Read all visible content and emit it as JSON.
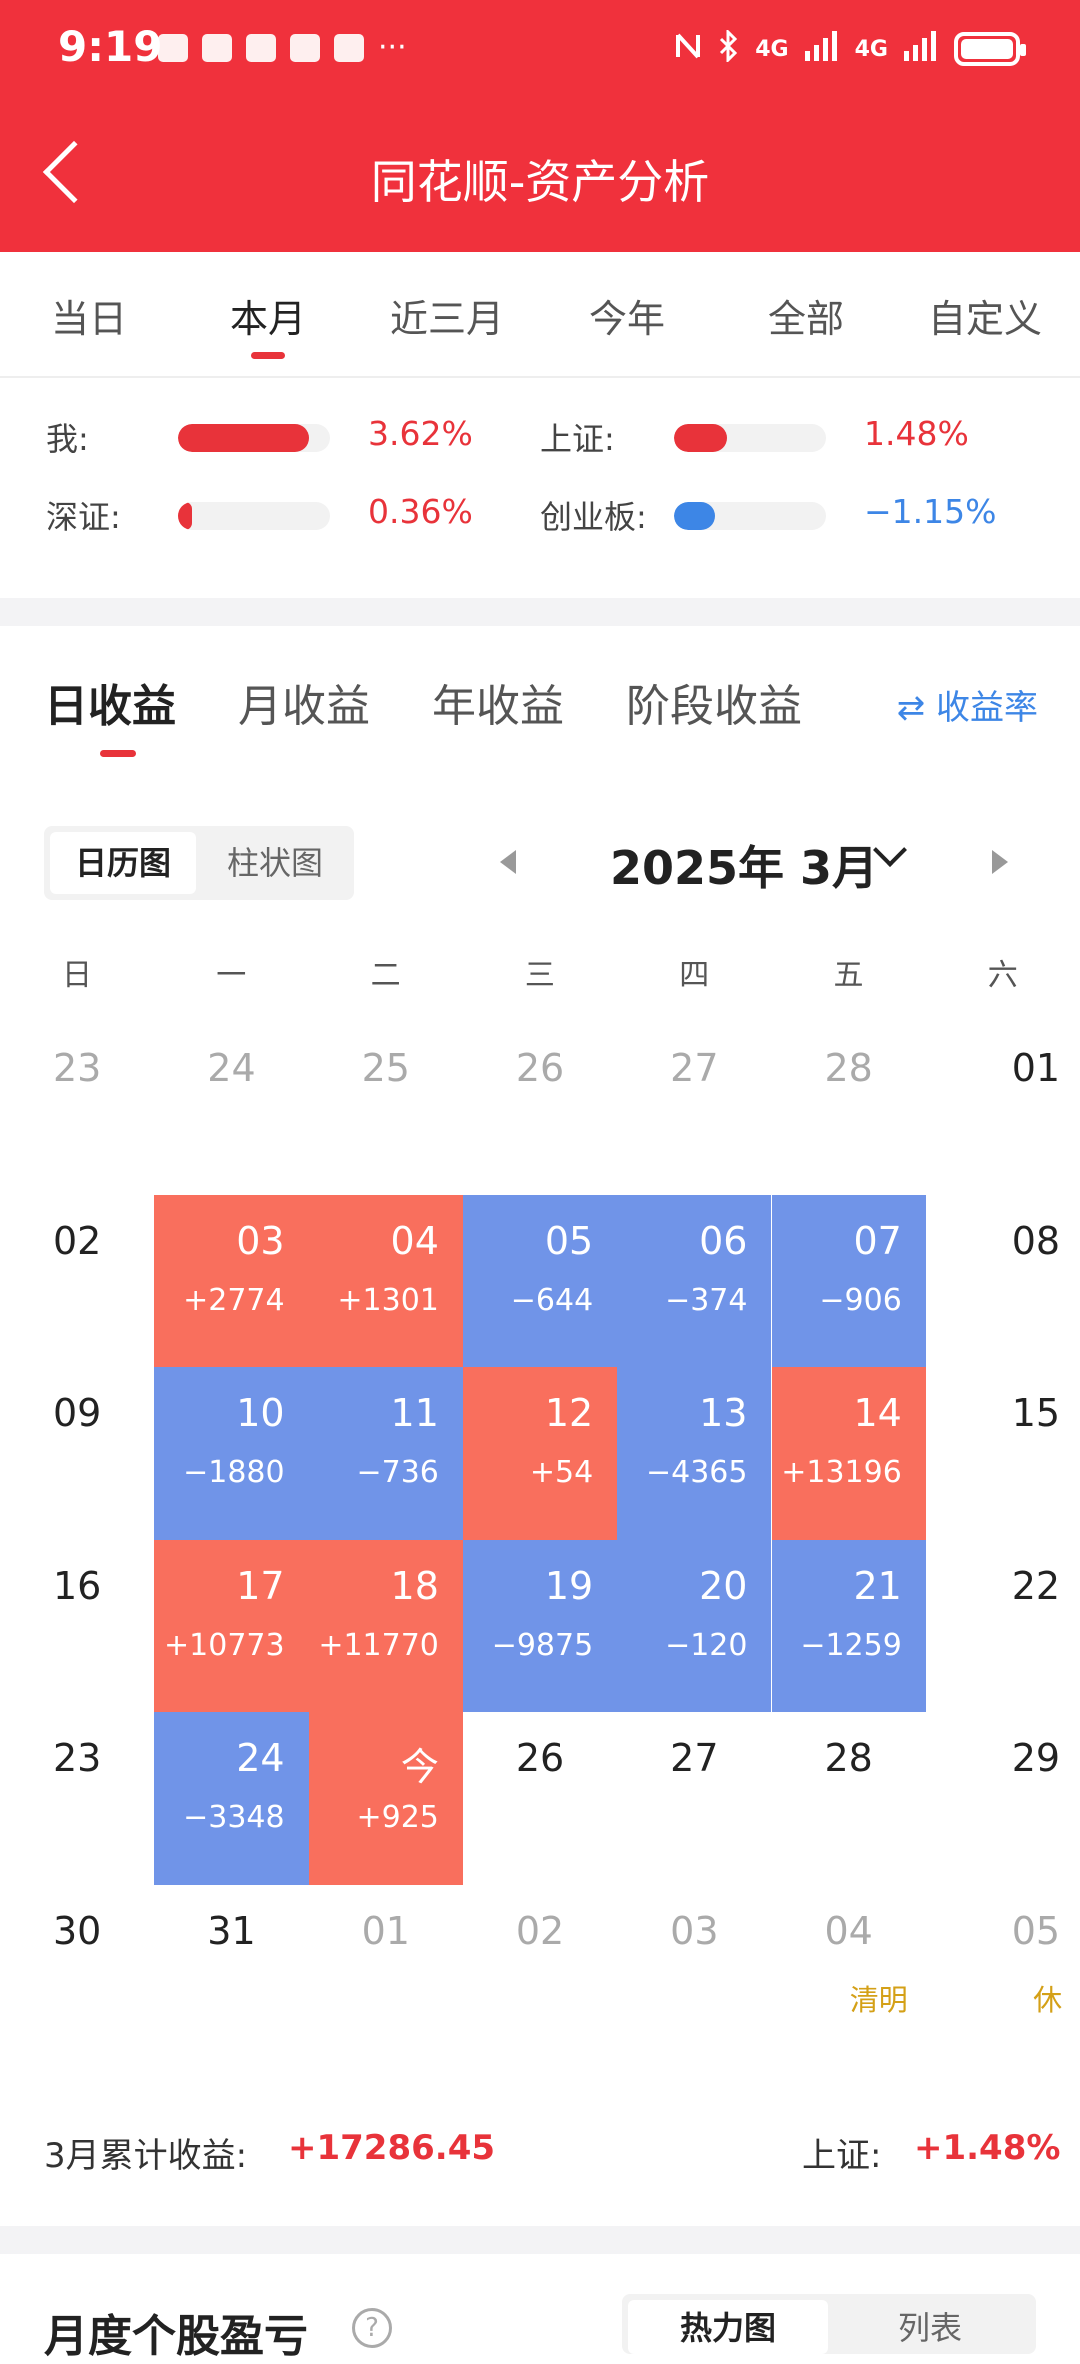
{
  "status": {
    "time": "9:19",
    "more": "···",
    "signal1": "4G",
    "signal2": "4G"
  },
  "nav": {
    "title": "同花顺-资产分析"
  },
  "period_tabs": [
    "当日",
    "本月",
    "近三月",
    "今年",
    "全部",
    "自定义"
  ],
  "period_active": 1,
  "compare": {
    "me": {
      "label": "我:",
      "value": "3.62%",
      "fill": 0.86,
      "color": "#e8333a"
    },
    "shanghai": {
      "label": "上证:",
      "value": "1.48%",
      "fill": 0.35,
      "color": "#e8333a"
    },
    "shenzhen": {
      "label": "深证:",
      "value": "0.36%",
      "fill": 0.09,
      "color": "#e8333a"
    },
    "chinext": {
      "label": "创业板:",
      "value": "−1.15%",
      "fill": 0.27,
      "color": "#3d86e6"
    }
  },
  "earn_tabs": [
    "日收益",
    "月收益",
    "年收益",
    "阶段收益"
  ],
  "rate_toggle": "⇄ 收益率",
  "view_toggle": {
    "calendar": "日历图",
    "bar": "柱状图"
  },
  "month_label": "2025年 3月",
  "weekdays": [
    "日",
    "一",
    "二",
    "三",
    "四",
    "五",
    "六"
  ],
  "calendar": [
    [
      {
        "d": "23",
        "s": "muted"
      },
      {
        "d": "24",
        "s": "muted"
      },
      {
        "d": "25",
        "s": "muted"
      },
      {
        "d": "26",
        "s": "muted"
      },
      {
        "d": "27",
        "s": "muted"
      },
      {
        "d": "28",
        "s": "muted"
      },
      {
        "d": "01",
        "s": "plain"
      }
    ],
    [
      {
        "d": "02",
        "s": "plain"
      },
      {
        "d": "03",
        "s": "up",
        "v": "+2774"
      },
      {
        "d": "04",
        "s": "up",
        "v": "+1301"
      },
      {
        "d": "05",
        "s": "down",
        "v": "−644"
      },
      {
        "d": "06",
        "s": "down",
        "v": "−374"
      },
      {
        "d": "07",
        "s": "down",
        "v": "−906"
      },
      {
        "d": "08",
        "s": "plain"
      }
    ],
    [
      {
        "d": "09",
        "s": "plain"
      },
      {
        "d": "10",
        "s": "down",
        "v": "−1880"
      },
      {
        "d": "11",
        "s": "down",
        "v": "−736"
      },
      {
        "d": "12",
        "s": "up",
        "v": "+54"
      },
      {
        "d": "13",
        "s": "down",
        "v": "−4365"
      },
      {
        "d": "14",
        "s": "up",
        "v": "+13196"
      },
      {
        "d": "15",
        "s": "plain"
      }
    ],
    [
      {
        "d": "16",
        "s": "plain"
      },
      {
        "d": "17",
        "s": "up",
        "v": "+10773"
      },
      {
        "d": "18",
        "s": "up",
        "v": "+11770"
      },
      {
        "d": "19",
        "s": "down",
        "v": "−9875"
      },
      {
        "d": "20",
        "s": "down",
        "v": "−120"
      },
      {
        "d": "21",
        "s": "down",
        "v": "−1259"
      },
      {
        "d": "22",
        "s": "plain"
      }
    ],
    [
      {
        "d": "23",
        "s": "plain"
      },
      {
        "d": "24",
        "s": "down",
        "v": "−3348"
      },
      {
        "d": "今",
        "s": "up",
        "v": "+925"
      },
      {
        "d": "26",
        "s": "plain"
      },
      {
        "d": "27",
        "s": "plain"
      },
      {
        "d": "28",
        "s": "plain"
      },
      {
        "d": "29",
        "s": "plain"
      }
    ],
    [
      {
        "d": "30",
        "s": "plain"
      },
      {
        "d": "31",
        "s": "plain"
      },
      {
        "d": "01",
        "s": "muted"
      },
      {
        "d": "02",
        "s": "muted"
      },
      {
        "d": "03",
        "s": "muted"
      },
      {
        "d": "04",
        "s": "muted",
        "h": "清明"
      },
      {
        "d": "05",
        "s": "muted",
        "h": "休"
      }
    ]
  ],
  "summary": {
    "label": "3月累计收益:",
    "value": "+17286.45",
    "index_label": "上证:",
    "index_value": "+1.48%"
  },
  "bottom": {
    "title": "月度个股盈亏",
    "help": "?",
    "heatmap": "热力图",
    "list": "列表"
  }
}
